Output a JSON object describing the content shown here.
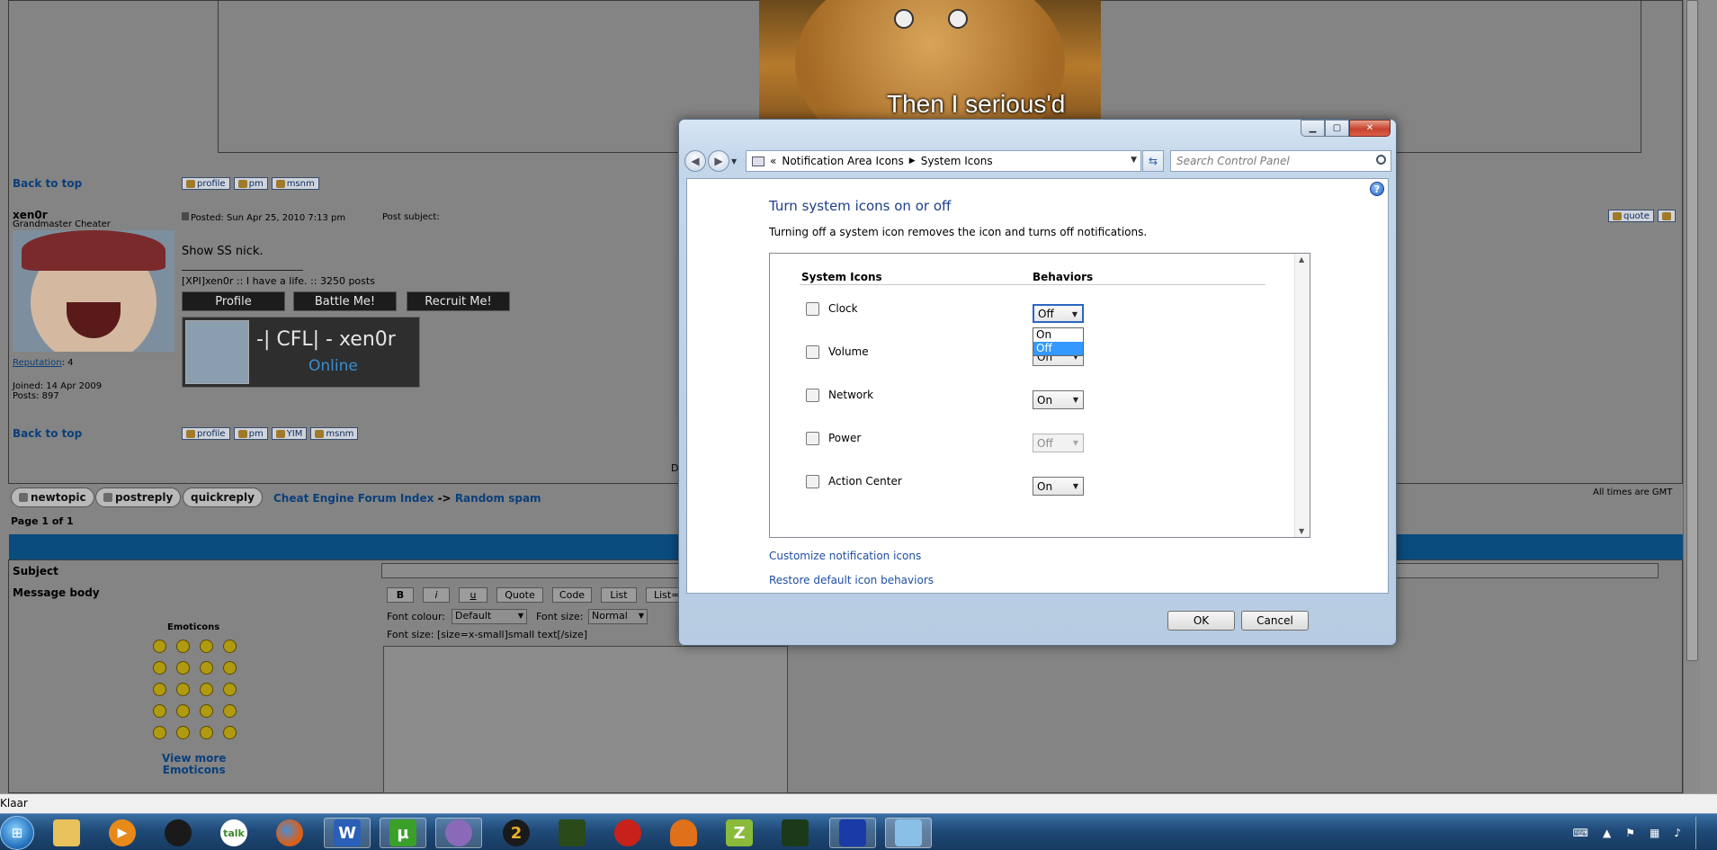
{
  "forum": {
    "back_to_top": "Back to top",
    "post_buttons_top": [
      "profile",
      "pm",
      "msnm"
    ],
    "post_buttons_bottom": [
      "profile",
      "pm",
      "YIM",
      "msnm"
    ],
    "username": "xen0r",
    "rank": "Grandmaster Cheater",
    "reputation_label": "Reputation",
    "reputation_value": ": 4",
    "joined": "Joined: 14 Apr 2009",
    "posts": "Posts: 897",
    "posted": "Posted: Sun Apr 25, 2010 7:13 pm",
    "post_subject": "Post subject:",
    "quote_btn": "quote",
    "body_text": "Show SS nick.",
    "signature": "[XPI]xen0r :: I have a life. :: 3250 posts",
    "sig_buttons": [
      "Profile",
      "Battle Me!",
      "Recruit Me!"
    ],
    "card_name": "-| CFL| -   xen0r",
    "card_status": "Online",
    "image_caption": "Then I serious'd",
    "new_topic": "newtopic",
    "post_reply": "postreply",
    "quick_reply": "quickreply",
    "breadcrumb_index": "Cheat Engine Forum Index",
    "breadcrumb_sep": "->",
    "breadcrumb_forum": "Random spam",
    "times": "All times are GMT",
    "page": "Page 1 of 1",
    "subject_label": "Subject",
    "message_label": "Message body",
    "emoticons_label": "Emoticons",
    "view_more": "View more",
    "view_more_2": "Emoticons",
    "toolbar": [
      "B",
      "i",
      "u",
      "Quote",
      "Code",
      "List",
      "List="
    ],
    "font_colour_label": "Font colour:",
    "font_colour_value": "Default",
    "font_size_label": "Font size:",
    "font_size_value": "Normal",
    "font_size_hint": "Font size: [size=x-small]small text[/size]",
    "edge_char": "D"
  },
  "status_bar": {
    "text": "Klaar"
  },
  "dialog": {
    "address_sep": "«",
    "breadcrumb": [
      "Notification Area Icons",
      "System Icons"
    ],
    "search_placeholder": "Search Control Panel",
    "help": "?",
    "heading": "Turn system icons on or off",
    "description": "Turning off a system icon removes the icon and turns off notifications.",
    "col_icons": "System Icons",
    "col_behaviors": "Behaviors",
    "rows": [
      {
        "name": "Clock",
        "value": "Off"
      },
      {
        "name": "Volume",
        "value": "On"
      },
      {
        "name": "Network",
        "value": "On"
      },
      {
        "name": "Power",
        "value": "Off"
      },
      {
        "name": "Action Center",
        "value": "On"
      }
    ],
    "dropdown_options": [
      "On",
      "Off"
    ],
    "link_customize": "Customize notification icons",
    "link_restore": "Restore default icon behaviors",
    "ok": "OK",
    "cancel": "Cancel"
  },
  "taskbar": {
    "items": [
      "explorer-icon",
      "media-player-icon",
      "steam-icon",
      "talk-icon",
      "firefox-icon",
      "word-icon",
      "utorrent-icon",
      "messenger-icon",
      "game-2-icon",
      "predator-icon",
      "app-red-icon",
      "mushroom-icon",
      "z-icon",
      "game-green-icon",
      "app-blue-icon",
      "control-panel-icon"
    ],
    "labels": [
      "",
      "",
      "",
      "talk",
      "",
      "W",
      "µ",
      "",
      "2",
      "",
      "",
      "",
      "Z",
      "",
      "",
      ""
    ]
  }
}
